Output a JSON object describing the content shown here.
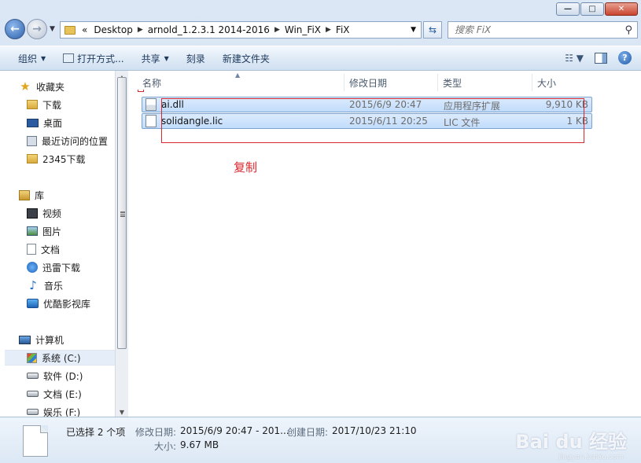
{
  "window": {
    "caption_buttons": {
      "minimize": "—",
      "maximize": "□",
      "close": "✕"
    }
  },
  "address_bar": {
    "overflow": "«",
    "crumbs": [
      "Desktop",
      "arnold_1.2.3.1 2014-2016",
      "Win_FiX",
      "FiX"
    ]
  },
  "search": {
    "placeholder": "搜索 FiX"
  },
  "toolbar": {
    "organize": "组织",
    "open_with": "打开方式...",
    "share": "共享",
    "burn": "刻录",
    "new_folder": "新建文件夹"
  },
  "sidebar": {
    "favorites": {
      "label": "收藏夹",
      "items": [
        "下载",
        "桌面",
        "最近访问的位置",
        "2345下载"
      ]
    },
    "libraries": {
      "label": "库",
      "items": [
        "视频",
        "图片",
        "文档",
        "迅雷下载",
        "音乐",
        "优酷影视库"
      ]
    },
    "computer": {
      "label": "计算机",
      "items": [
        "系统 (C:)",
        "软件 (D:)",
        "文档 (E:)",
        "娱乐 (F:)"
      ]
    }
  },
  "columns": {
    "name": "名称",
    "date": "修改日期",
    "type": "类型",
    "size": "大小"
  },
  "files": [
    {
      "name": "ai.dll",
      "date": "2015/6/9 20:47",
      "type": "应用程序扩展",
      "size": "9,910 KB"
    },
    {
      "name": "solidangle.lic",
      "date": "2015/6/11 20:25",
      "type": "LIC 文件",
      "size": "1 KB"
    }
  ],
  "annotation": {
    "text": "复制",
    "color": "#d9272e"
  },
  "details": {
    "selected": "已选择 2 个项",
    "modified_label": "修改日期:",
    "modified_value": "2015/6/9 20:47 - 201...",
    "created_label": "创建日期:",
    "created_value": "2017/10/23 21:10",
    "size_label": "大小:",
    "size_value": "9.67 MB"
  },
  "watermark": {
    "brand": "Bai du 经验",
    "url": "jingyan.baidu.com"
  }
}
